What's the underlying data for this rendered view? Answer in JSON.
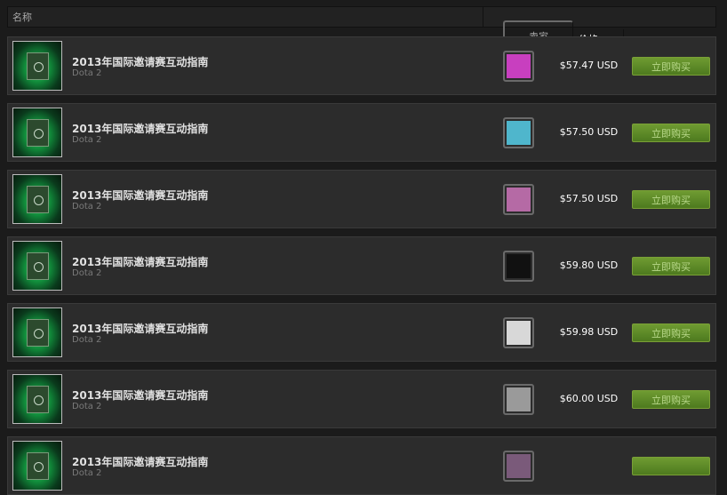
{
  "header": {
    "name_label": "名称",
    "seller_label": "卖家",
    "price_label": "价格"
  },
  "listings": [
    {
      "title": "2013年国际邀请赛互动指南",
      "game": "Dota 2",
      "price": "$57.47 USD",
      "buy_label": "立即购买",
      "avatar_color": "#c83fbf"
    },
    {
      "title": "2013年国际邀请赛互动指南",
      "game": "Dota 2",
      "price": "$57.50 USD",
      "buy_label": "立即购买",
      "avatar_color": "#4fb6cc"
    },
    {
      "title": "2013年国际邀请赛互动指南",
      "game": "Dota 2",
      "price": "$57.50 USD",
      "buy_label": "立即购买",
      "avatar_color": "#b56aa5"
    },
    {
      "title": "2013年国际邀请赛互动指南",
      "game": "Dota 2",
      "price": "$59.80 USD",
      "buy_label": "立即购买",
      "avatar_color": "#111111"
    },
    {
      "title": "2013年国际邀请赛互动指南",
      "game": "Dota 2",
      "price": "$59.98 USD",
      "buy_label": "立即购买",
      "avatar_color": "#d8d8d8"
    },
    {
      "title": "2013年国际邀请赛互动指南",
      "game": "Dota 2",
      "price": "$60.00 USD",
      "buy_label": "立即购买",
      "avatar_color": "#9a9a9a"
    },
    {
      "title": "2013年国际邀请赛互动指南",
      "game": "Dota 2",
      "price": "",
      "buy_label": "",
      "avatar_color": "#7a5a7a"
    }
  ],
  "icons": {
    "item_image": "interactive-compendium-icon",
    "seller_avatar": "seller-avatar-icon"
  }
}
